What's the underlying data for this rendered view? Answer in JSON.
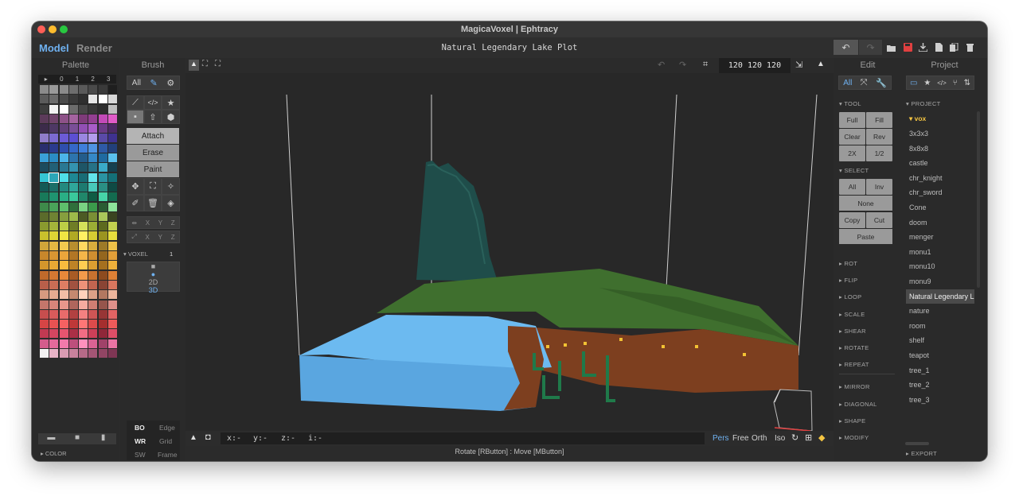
{
  "window": {
    "title": "MagicaVoxel | Ephtracy"
  },
  "menubar": {
    "modes": [
      "Model",
      "Render"
    ],
    "document_title": "Natural Legendary Lake Plot",
    "toolbar_icons": [
      "undo-icon",
      "redo-icon",
      "open-folder-icon",
      "save-icon",
      "export-icon",
      "new-file-icon",
      "duplicate-icon",
      "delete-icon"
    ]
  },
  "palette": {
    "header": "Palette",
    "tabs": [
      "▸",
      "0",
      "1",
      "2",
      "3"
    ],
    "footer_label": "▸ COLOR",
    "colors": [
      "#8b8b8b",
      "#9a9a9a",
      "#8a8a8a",
      "#6e6e6e",
      "#5a5a5a",
      "#4a4a4a",
      "#3a3a3a",
      "#1f1f1f",
      "#5b5b5b",
      "#6b6b6b",
      "#4a4a4a",
      "#3a3a3a",
      "#2f2f2f",
      "#e6e6e6",
      "#ffffff",
      "#d8d8d8",
      "#3e3e3e",
      "#f2f2f2",
      "#ffffff",
      "#6c6c6c",
      "#474747",
      "#383838",
      "#2d2d2d",
      "#bebebe",
      "#5c3b5a",
      "#70446b",
      "#8d5288",
      "#a463a0",
      "#7e3b7a",
      "#933f91",
      "#c34ab8",
      "#e05bc8",
      "#3c2b4a",
      "#4e3864",
      "#624079",
      "#7a4f98",
      "#924fb4",
      "#a95cc8",
      "#6a3a86",
      "#4d2a66",
      "#8f7cc9",
      "#7b6ad0",
      "#6c5bd6",
      "#5c4fd3",
      "#9a86e1",
      "#b39cec",
      "#5a4aa8",
      "#3f3290",
      "#2a2f6e",
      "#2b3b8d",
      "#2f4fae",
      "#3568c9",
      "#3f7fdb",
      "#4f94e3",
      "#2e5aa6",
      "#22407b",
      "#3aa0d8",
      "#2b8cc4",
      "#4cb4e8",
      "#2d74ad",
      "#235c8b",
      "#3588c6",
      "#1f6aa0",
      "#5ac0ee",
      "#1c4b5e",
      "#226076",
      "#2a7893",
      "#3493b0",
      "#1e5566",
      "#267286",
      "#3aaac8",
      "#154050",
      "#36c5d4",
      "#2ca6b8",
      "#4fdde8",
      "#1e8894",
      "#186c75",
      "#62e3ea",
      "#2a93a2",
      "#147078",
      "#145a55",
      "#1a6e67",
      "#23897f",
      "#2fa79a",
      "#1d7a70",
      "#48c9ba",
      "#2a8f84",
      "#0f4a44",
      "#187a5a",
      "#1f9470",
      "#2aaf85",
      "#3ac99c",
      "#20876a",
      "#0f5c44",
      "#46d4a8",
      "#136b4f",
      "#3e8a4a",
      "#4aa359",
      "#5fbf6c",
      "#2f6f3b",
      "#79d283",
      "#3b9a4b",
      "#2a5c33",
      "#8de39a",
      "#5b6b2b",
      "#6f8333",
      "#869f3e",
      "#9dba4a",
      "#4c5a24",
      "#7a8f35",
      "#a9c65a",
      "#3a4420",
      "#8a9a2f",
      "#a3b43a",
      "#bccd46",
      "#6f7d26",
      "#d3e05a",
      "#9aac35",
      "#5d6a1f",
      "#c2d04f",
      "#c9c12c",
      "#ded535",
      "#f0e543",
      "#b0a924",
      "#fff163",
      "#d6cc33",
      "#9b9420",
      "#e8de3d",
      "#cfa53a",
      "#e3b743",
      "#f2c94f",
      "#b78e2f",
      "#ffd861",
      "#d9ad3d",
      "#9d7a28",
      "#eec148",
      "#c8872b",
      "#d99532",
      "#eba53b",
      "#b27625",
      "#f5b649",
      "#cf8e30",
      "#94661e",
      "#e39f38",
      "#d4962c",
      "#e8a834",
      "#f7bb3e",
      "#be8326",
      "#ffcc52",
      "#dc9e31",
      "#a5701f",
      "#efb03a",
      "#c06a2b",
      "#d47832",
      "#e8883a",
      "#a85b25",
      "#f39a4b",
      "#c8712f",
      "#8d4b1f",
      "#de8035",
      "#b85f4a",
      "#ca6d55",
      "#de7d63",
      "#a25240",
      "#ee9279",
      "#c26550",
      "#8a4434",
      "#d9765e",
      "#d79a80",
      "#e6ab91",
      "#f2bea6",
      "#c5896f",
      "#ffd2bc",
      "#dba187",
      "#b27860",
      "#ecb59c",
      "#c5766b",
      "#d8857a",
      "#e8978b",
      "#b0665c",
      "#f5ab9f",
      "#cf7e73",
      "#96554c",
      "#e0908a",
      "#c74e4e",
      "#d95b5b",
      "#e96b6b",
      "#b24141",
      "#f48181",
      "#cf5555",
      "#973535",
      "#e26363",
      "#d64545",
      "#e85252",
      "#f56161",
      "#be3838",
      "#ff7676",
      "#dc4b4b",
      "#a52e2e",
      "#ef5a5a",
      "#c23a52",
      "#d44660",
      "#e6556f",
      "#ab3046",
      "#f26d84",
      "#cc4058",
      "#8f2739",
      "#de4e67",
      "#d45c8c",
      "#e46a9b",
      "#f27aab",
      "#bd4f7c",
      "#ff91bd",
      "#d96393",
      "#a04269",
      "#ea74a4",
      "#f2f2f2",
      "#e7b3c6",
      "#d99bb2",
      "#c9829d",
      "#b66a88",
      "#a45575",
      "#924564",
      "#7f3654"
    ],
    "selected_index": 73
  },
  "brush": {
    "header": "Brush",
    "filter": "All",
    "modes": [
      "Attach",
      "Erase",
      "Paint"
    ],
    "axes": [
      "X",
      "Y",
      "Z"
    ],
    "voxel_label": "▾ VOXEL",
    "voxel_value": "1",
    "dims": [
      "2D",
      "3D"
    ],
    "bottom_left": [
      "BO",
      "WR",
      "SW"
    ],
    "bottom_right": [
      "Edge",
      "Grid",
      "Frame"
    ]
  },
  "viewport": {
    "size_readout": "120 120 120",
    "coords": [
      "x:-",
      "y:-",
      "z:-",
      "i:-"
    ],
    "view_modes": [
      "Pers",
      "Free",
      "Orth",
      "Iso"
    ],
    "hint": "Rotate [RButton] : Move [MButton]"
  },
  "edit": {
    "header": "Edit",
    "filter": "All",
    "tool_label": "▾ TOOL",
    "tool_buttons": [
      "Full",
      "Fill",
      "Clear",
      "Rev",
      "2X",
      "1/2"
    ],
    "select_label": "▾ SELECT",
    "select_buttons": [
      "All",
      "Inv"
    ],
    "select_wide": [
      "None"
    ],
    "select_pairs": [
      "Copy",
      "Cut"
    ],
    "select_last": "Paste",
    "sections_a": [
      "▸ ROT",
      "▸ FLIP",
      "▸ LOOP",
      "▸ SCALE",
      "▸ SHEAR",
      "▸ ROTATE",
      "▸ REPEAT"
    ],
    "sections_b": [
      "▸ MIRROR",
      "▸ DIAGONAL",
      "▸ SHAPE",
      "▸ MODIFY"
    ]
  },
  "project": {
    "header": "Project",
    "section": "▾ PROJECT",
    "folder": "▾ vox",
    "items": [
      "3x3x3",
      "8x8x8",
      "castle",
      "chr_knight",
      "chr_sword",
      "Cone",
      "doom",
      "menger",
      "monu1",
      "monu10",
      "monu9",
      "Natural Legendary L",
      "nature",
      "room",
      "shelf",
      "teapot",
      "tree_1",
      "tree_2",
      "tree_3"
    ],
    "selected": "Natural Legendary L",
    "footer": "▸ EXPORT"
  },
  "colors": {
    "accent": "#6fb1f0",
    "folder": "#f5c542",
    "water": "#6cbaf0",
    "grass": "#3f6f2e",
    "dirt": "#7d3f1f",
    "save": "#e04040"
  }
}
